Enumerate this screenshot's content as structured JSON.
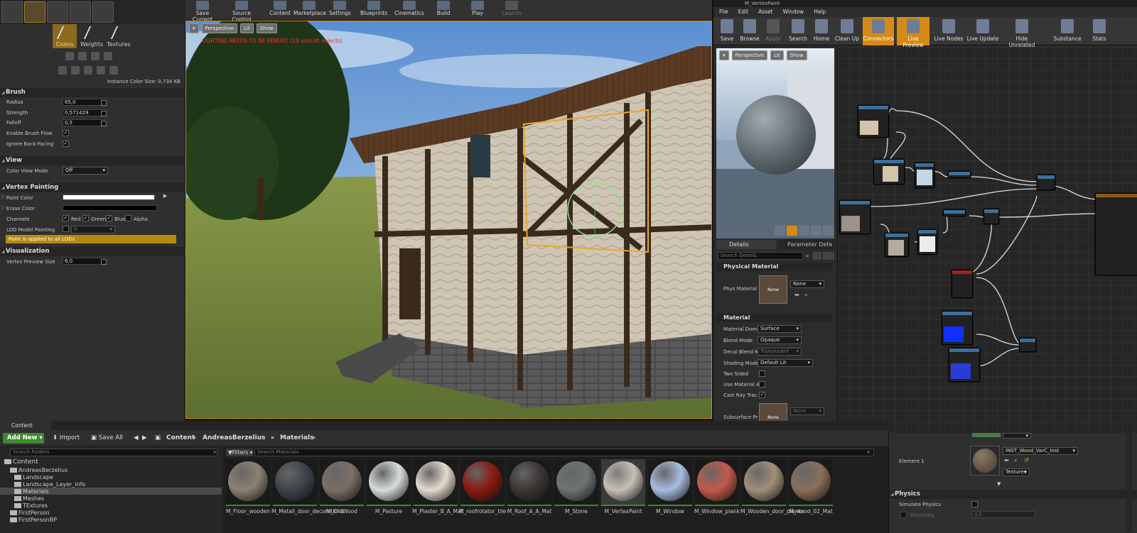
{
  "left_panel": {
    "tool_tabs": [
      {
        "label": "Colors"
      },
      {
        "label": "Weights"
      },
      {
        "label": "Textures"
      }
    ],
    "instance_color_size": "Instance Color Size: 0,734 KB",
    "brush": {
      "title": "Brush",
      "radius_label": "Radius",
      "radius": "65,0",
      "strength_label": "Strength",
      "strength": "0,571429",
      "falloff_label": "Falloff",
      "falloff": "0,5",
      "enable_flow_label": "Enable Brush Flow",
      "ignore_backfacing_label": "Ignore Back-Facing"
    },
    "view": {
      "title": "View",
      "color_view_mode_label": "Color View Mode",
      "color_view_mode": "Off"
    },
    "vertex_painting": {
      "title": "Vertex Painting",
      "paint_color_label": "Paint Color",
      "erase_color_label": "Erase Color",
      "channels_label": "Channels",
      "red": "Red",
      "green": "Green",
      "blue": "Blue",
      "alpha": "Alpha",
      "lod_label": "LOD Model Painting",
      "lod_value": "0",
      "banner": "Paint is applied to all LODs"
    },
    "visualization": {
      "title": "Visualization",
      "preview_size_label": "Vertex Preview Size",
      "preview_size": "6,0"
    }
  },
  "top_toolbar": {
    "items": [
      "Save Current",
      "Source Control",
      "Content",
      "Marketplace",
      "Settings",
      "Blueprints",
      "Cinematics",
      "Build",
      "Play",
      "Launch"
    ]
  },
  "viewport": {
    "perspective": "Perspective",
    "lit": "Lit",
    "show": "Show",
    "warning": "LIGHTING NEEDS TO BE REBUILT (19 unbuilt objects)"
  },
  "material_editor": {
    "title": "M_VertexPaint",
    "menu": [
      "File",
      "Edit",
      "Asset",
      "Window",
      "Help"
    ],
    "toolbar": [
      "Save",
      "Browse",
      "Apply",
      "Search",
      "Home",
      "Clean Up",
      "Connectors",
      "Live Preview",
      "Live Nodes",
      "Live Update",
      "Hide Unrelated",
      "Substance",
      "Stats"
    ],
    "preview": {
      "perspective": "Perspective",
      "lit": "Lit",
      "show": "Show"
    },
    "details": {
      "tab1": "Details",
      "tab2": "Parameter Defa",
      "search_placeholder": "Search Details",
      "phys_section": "Physical Material",
      "phys_label": "Phys Material",
      "phys_thumb": "None",
      "phys_value": "None",
      "material_section": "Material",
      "domain_label": "Material Doma",
      "domain": "Surface",
      "blend_label": "Blend Mode",
      "blend": "Opaque",
      "decal_label": "Decal Blend M",
      "decal": "Translucent",
      "shading_label": "Shading Mode",
      "shading": "Default Lit",
      "two_sided_label": "Two Sided",
      "use_material_label": "Use Material A",
      "cast_ray_label": "Cast Ray Trac",
      "subsurface_label": "Subsurface Pr",
      "subsurface_thumb": "None",
      "subsurface_value": "None"
    }
  },
  "content_browser": {
    "tab": "Content Browser",
    "add_new": "Add New",
    "import": "Import",
    "save_all": "Save All",
    "path": [
      "Content",
      "AndreasBerzelius",
      "Materials"
    ],
    "search_folders": "Search Folders",
    "filters": "Filters",
    "search_materials": "Search Materials",
    "tree": [
      {
        "label": "Content",
        "level": 0
      },
      {
        "label": "AndreasBerzelius",
        "level": 1
      },
      {
        "label": "Landscape",
        "level": 2
      },
      {
        "label": "Landscape_Layer_info",
        "level": 2
      },
      {
        "label": "Materials",
        "level": 2
      },
      {
        "label": "Meshes",
        "level": 2
      },
      {
        "label": "TExtures",
        "level": 2
      },
      {
        "label": "FirstPerson",
        "level": 1
      },
      {
        "label": "FirstPersonBP",
        "level": 1
      }
    ],
    "assets": [
      {
        "name": "M_Floor_wooden",
        "color": "#8a8270"
      },
      {
        "name": "M_Metall_door_decorations",
        "color": "#3e444a"
      },
      {
        "name": "M_OldWood",
        "color": "#7c6e66"
      },
      {
        "name": "M_Pasture",
        "color": "#d8dcdc"
      },
      {
        "name": "M_Plaster_B_A_Mat",
        "color": "#e2dacd"
      },
      {
        "name": "M_roofrotator_tile",
        "color": "#8a1a10"
      },
      {
        "name": "M_Roof_A_A_Mat",
        "color": "#3a3634"
      },
      {
        "name": "M_Stone",
        "color": "#6c7474"
      },
      {
        "name": "M_VertexPaint",
        "color": "#c6c0b2"
      },
      {
        "name": "M_Window",
        "color": "#a8bce0"
      },
      {
        "name": "M_Window_plank",
        "color": "#c25a48"
      },
      {
        "name": "M_Wooden_door_planks",
        "color": "#a0907a"
      },
      {
        "name": "M_wood_02_Mat",
        "color": "#8a6e5a"
      }
    ]
  },
  "bottom_right": {
    "element_label": "Element 1",
    "material_name": "INST_Wood_VarC_Inst",
    "textures": "Textures",
    "physics": "Physics",
    "simulate_physics": "Simulate Physics",
    "mass_label": "MassInKg",
    "mass_value": "0,0"
  }
}
